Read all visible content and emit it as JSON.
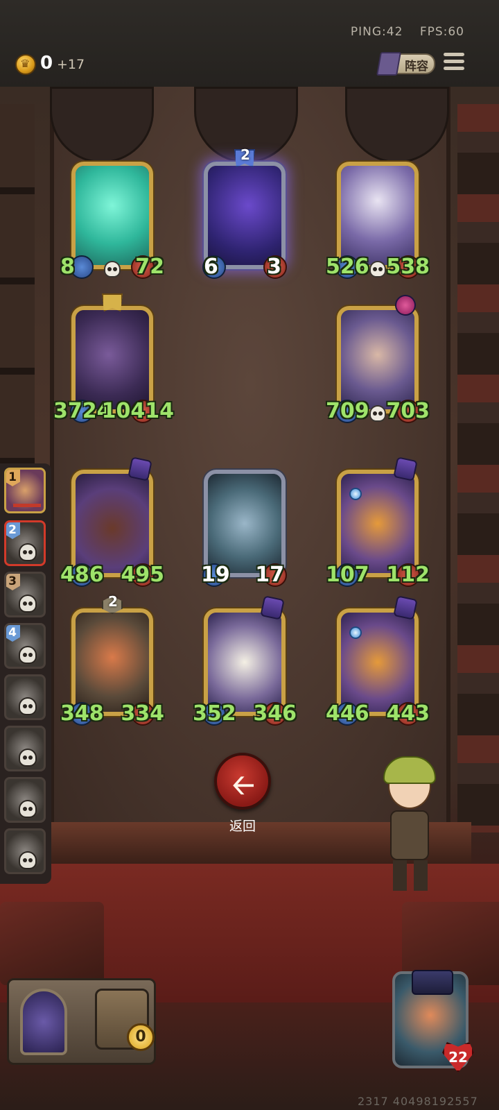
{
  "status": {
    "ping": "PING:42",
    "fps": "FPS:60"
  },
  "economy": {
    "gold": "0",
    "income": "+17",
    "coin_icon": "crown-coin-icon"
  },
  "header": {
    "lineup_label": "阵容",
    "menu_icon": "hamburger-menu-icon"
  },
  "board": {
    "row1": [
      {
        "atk": "8",
        "hp": "72",
        "frame": "gold",
        "art": "ghost-warrior"
      },
      {
        "atk": "6",
        "hp": "3",
        "frame": "silver",
        "tier": "2",
        "art": "void-beast"
      },
      {
        "atk": "526",
        "hp": "538",
        "frame": "gold",
        "art": "wizard"
      }
    ],
    "row2": [
      {
        "atk": "3724",
        "hp": "10414",
        "frame": "gold",
        "art": "dragon"
      },
      {
        "atk": "709",
        "hp": "703",
        "frame": "gold",
        "art": "actor"
      }
    ],
    "row3": [
      {
        "atk": "486",
        "hp": "495",
        "frame": "gold",
        "art": "boar"
      },
      {
        "atk": "19",
        "hp": "17",
        "frame": "silver",
        "art": "beast"
      },
      {
        "atk": "107",
        "hp": "112",
        "frame": "gold",
        "art": "cat"
      }
    ],
    "row4": [
      {
        "atk": "348",
        "hp": "334",
        "frame": "gold",
        "tier": "2",
        "art": "archer"
      },
      {
        "atk": "352",
        "hp": "346",
        "frame": "gold",
        "art": "cow"
      },
      {
        "atk": "446",
        "hp": "443",
        "frame": "gold",
        "art": "cat"
      }
    ]
  },
  "players": [
    {
      "rank": "1",
      "state": "first"
    },
    {
      "rank": "2",
      "state": "active"
    },
    {
      "rank": "3",
      "state": "eliminated"
    },
    {
      "rank": "4",
      "state": "eliminated"
    },
    {
      "rank": "",
      "state": "eliminated"
    },
    {
      "rank": "",
      "state": "eliminated"
    },
    {
      "rank": "",
      "state": "eliminated"
    },
    {
      "rank": "",
      "state": "eliminated"
    }
  ],
  "actions": {
    "back_label": "返回",
    "back_icon": "arrow-left-icon"
  },
  "shop": {
    "gold": "0"
  },
  "hero": {
    "health": "22"
  },
  "footer": {
    "uid": "2317 40498192557"
  }
}
